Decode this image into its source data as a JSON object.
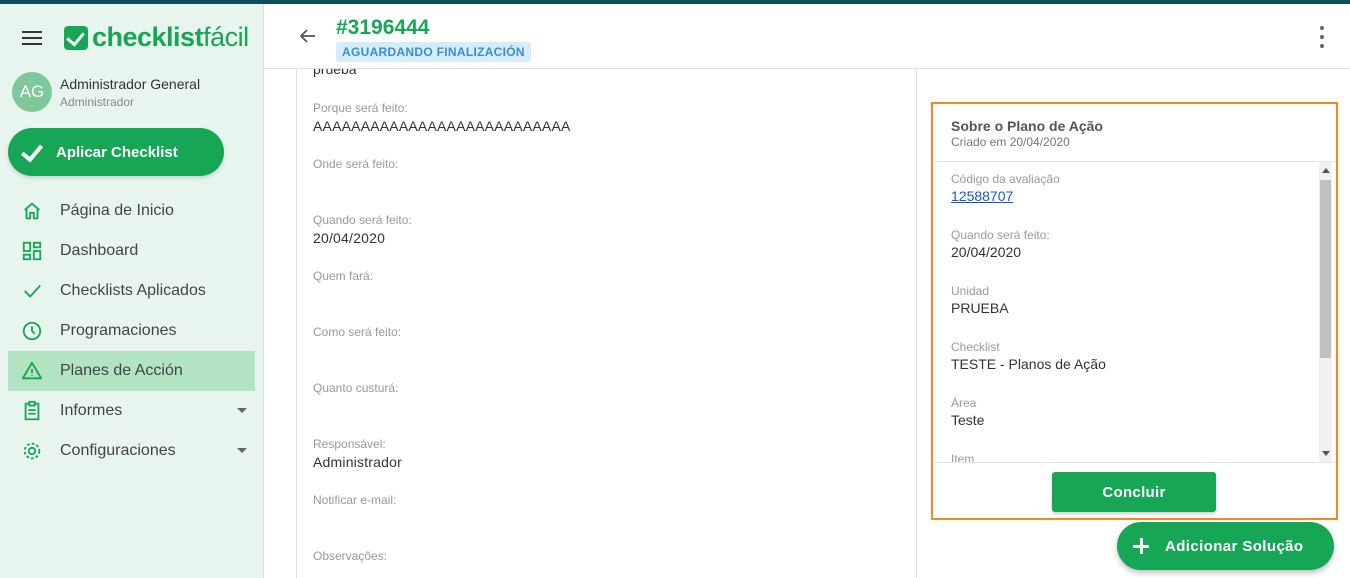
{
  "sidebar": {
    "logo_bold": "checklist",
    "logo_light": "fácil",
    "user": {
      "initials": "AG",
      "name": "Administrador General",
      "role": "Administrador"
    },
    "apply_button": "Aplicar Checklist",
    "items": [
      {
        "label": "Página de Inicio",
        "icon": "home-icon"
      },
      {
        "label": "Dashboard",
        "icon": "dashboard-icon"
      },
      {
        "label": "Checklists Aplicados",
        "icon": "check-icon"
      },
      {
        "label": "Programaciones",
        "icon": "clock-icon"
      },
      {
        "label": "Planes de Acción",
        "icon": "warning-icon",
        "active": true
      },
      {
        "label": "Informes",
        "icon": "report-icon",
        "expandable": true
      },
      {
        "label": "Configuraciones",
        "icon": "gear-icon",
        "expandable": true
      }
    ]
  },
  "header": {
    "ticket": "#3196444",
    "status": "AGUARDANDO FINALIZACIÓN"
  },
  "details": {
    "top_cut": "prueba",
    "fields": [
      {
        "label": "Porque será feito:",
        "value": "AAAAAAAAAAAAAAAAAAAAAAAAAAA"
      },
      {
        "label": "Onde será feito:",
        "value": ""
      },
      {
        "label": "Quando será feito:",
        "value": "20/04/2020"
      },
      {
        "label": "Quem fará:",
        "value": ""
      },
      {
        "label": "Como será feito:",
        "value": ""
      },
      {
        "label": "Quanto custurá:",
        "value": ""
      },
      {
        "label": "Responsável:",
        "value": "Administrador"
      },
      {
        "label": "Notificar e-mail:",
        "value": ""
      },
      {
        "label": "Observações:",
        "value": ""
      }
    ]
  },
  "panel": {
    "title": "Sobre o Plano de Ação",
    "subtitle": "Criado em 20/04/2020",
    "fields": [
      {
        "label": "Código da avaliação",
        "value": "12588707",
        "link": true
      },
      {
        "label": "Quando será feito:",
        "value": "20/04/2020"
      },
      {
        "label": "Unidad",
        "value": "PRUEBA"
      },
      {
        "label": "Checklist",
        "value": "TESTE - Planos de Ação"
      },
      {
        "label": "Área",
        "value": "Teste"
      },
      {
        "label": "Item",
        "value": ""
      }
    ],
    "conclude_button": "Concluir"
  },
  "fab_label": "Adicionar Solução",
  "colors": {
    "brand": "#17a556",
    "highlight": "#f58a1f",
    "status_bg": "#d6ecfb",
    "status_text": "#3a8dd1"
  }
}
